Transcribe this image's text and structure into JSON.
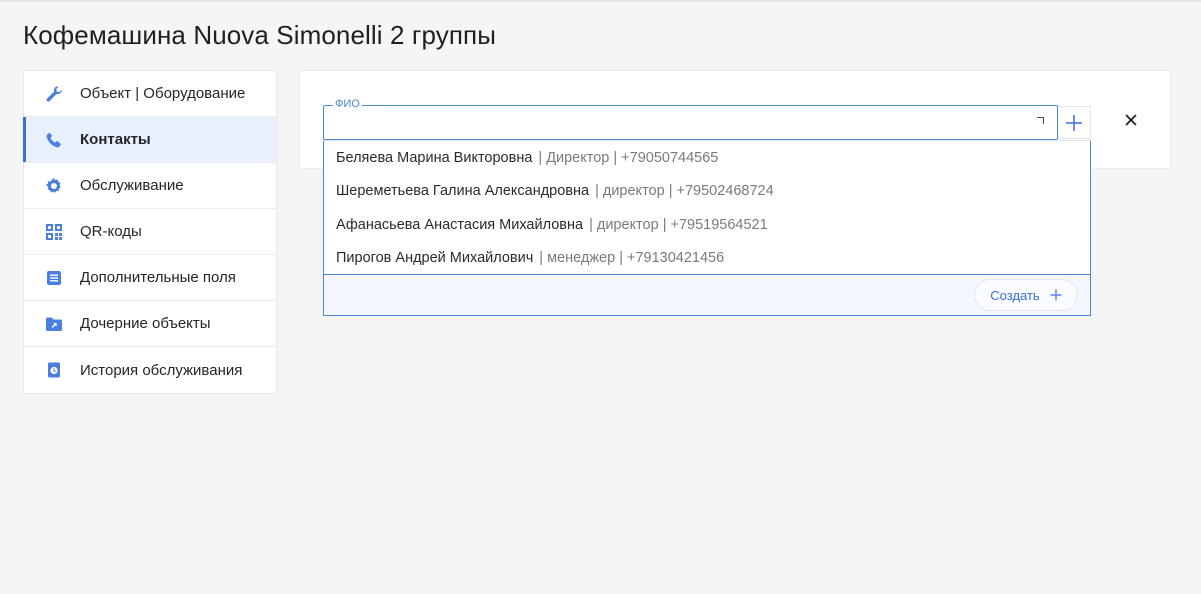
{
  "page": {
    "title": "Кофемашина Nuova Simonelli 2 группы"
  },
  "sidebar": {
    "items": [
      {
        "label": "Объект | Оборудование",
        "icon": "wrench-icon",
        "active": false
      },
      {
        "label": "Контакты",
        "icon": "phone-icon",
        "active": true
      },
      {
        "label": "Обслуживание",
        "icon": "gear-icon",
        "active": false
      },
      {
        "label": "QR-коды",
        "icon": "qr-code-icon",
        "active": false
      },
      {
        "label": "Дополнительные поля",
        "icon": "list-document-icon",
        "active": false
      },
      {
        "label": "Дочерние объекты",
        "icon": "folder-icon",
        "active": false
      },
      {
        "label": "История обслуживания",
        "icon": "history-icon",
        "active": false
      }
    ]
  },
  "contact_form": {
    "fio_label": "ФИО",
    "fio_value": "",
    "create_label": "Создать"
  },
  "suggestions": [
    {
      "name": "Беляева Марина Викторовна",
      "meta": "| Директор | +79050744565"
    },
    {
      "name": "Шереметьева Галина Александровна",
      "meta": "| директор | +79502468724"
    },
    {
      "name": "Афанасьева Анастасия Михайловна",
      "meta": "| директор | +79519564521"
    },
    {
      "name": "Пирогов Андрей Михайлович",
      "meta": "| менеджер | +79130421456"
    }
  ],
  "colors": {
    "accent": "#3a6fd8",
    "active_bg": "#e9f0fd",
    "field_border": "#4a88d6"
  }
}
